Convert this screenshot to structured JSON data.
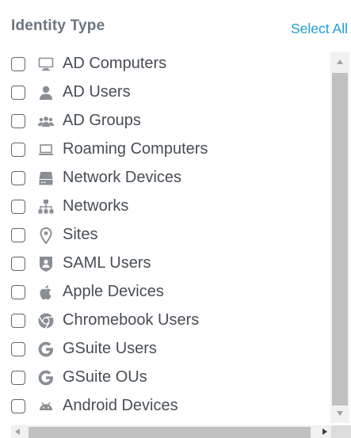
{
  "header": {
    "title": "Identity Type",
    "select_all_label": "Select All"
  },
  "items": [
    {
      "label": "AD Computers",
      "icon": "monitor-icon"
    },
    {
      "label": "AD Users",
      "icon": "user-icon"
    },
    {
      "label": "AD Groups",
      "icon": "group-icon"
    },
    {
      "label": "Roaming Computers",
      "icon": "laptop-icon"
    },
    {
      "label": "Network Devices",
      "icon": "server-icon"
    },
    {
      "label": "Networks",
      "icon": "network-tree-icon"
    },
    {
      "label": "Sites",
      "icon": "location-pin-icon"
    },
    {
      "label": "SAML Users",
      "icon": "shield-user-icon"
    },
    {
      "label": "Apple Devices",
      "icon": "apple-icon"
    },
    {
      "label": "Chromebook Users",
      "icon": "chrome-icon"
    },
    {
      "label": "GSuite Users",
      "icon": "google-g-icon"
    },
    {
      "label": "GSuite OUs",
      "icon": "google-g-icon"
    },
    {
      "label": "Android Devices",
      "icon": "android-icon"
    }
  ],
  "colors": {
    "title": "#6b7581",
    "link": "#1e9fd4",
    "label": "#484e55",
    "icon": "#8a8f95"
  }
}
